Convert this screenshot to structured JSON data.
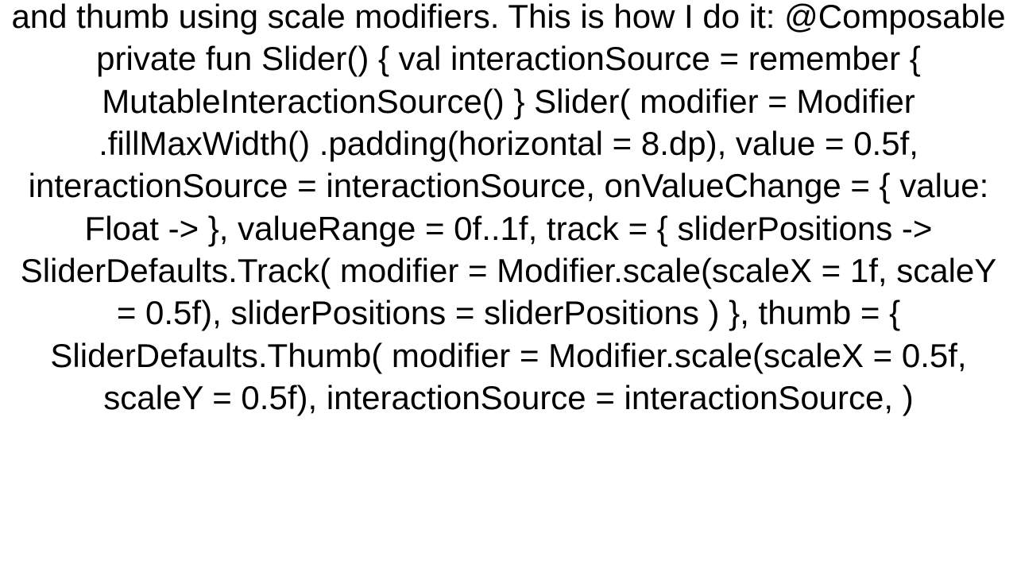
{
  "body": "and thumb using scale modifiers. This is how I do it: @Composable private fun Slider() {     val interactionSource = remember { MutableInteractionSource() }     Slider(         modifier = Modifier             .fillMaxWidth()             .padding(horizontal = 8.dp),         value = 0.5f,         interactionSource = interactionSource,         onValueChange = { value: Float -> },         valueRange = 0f..1f,         track = { sliderPositions ->             SliderDefaults.Track(                 modifier = Modifier.scale(scaleX = 1f, scaleY = 0.5f),                 sliderPositions = sliderPositions             )         },         thumb = {             SliderDefaults.Thumb(                 modifier = Modifier.scale(scaleX = 0.5f, scaleY = 0.5f),                 interactionSource = interactionSource,             )"
}
